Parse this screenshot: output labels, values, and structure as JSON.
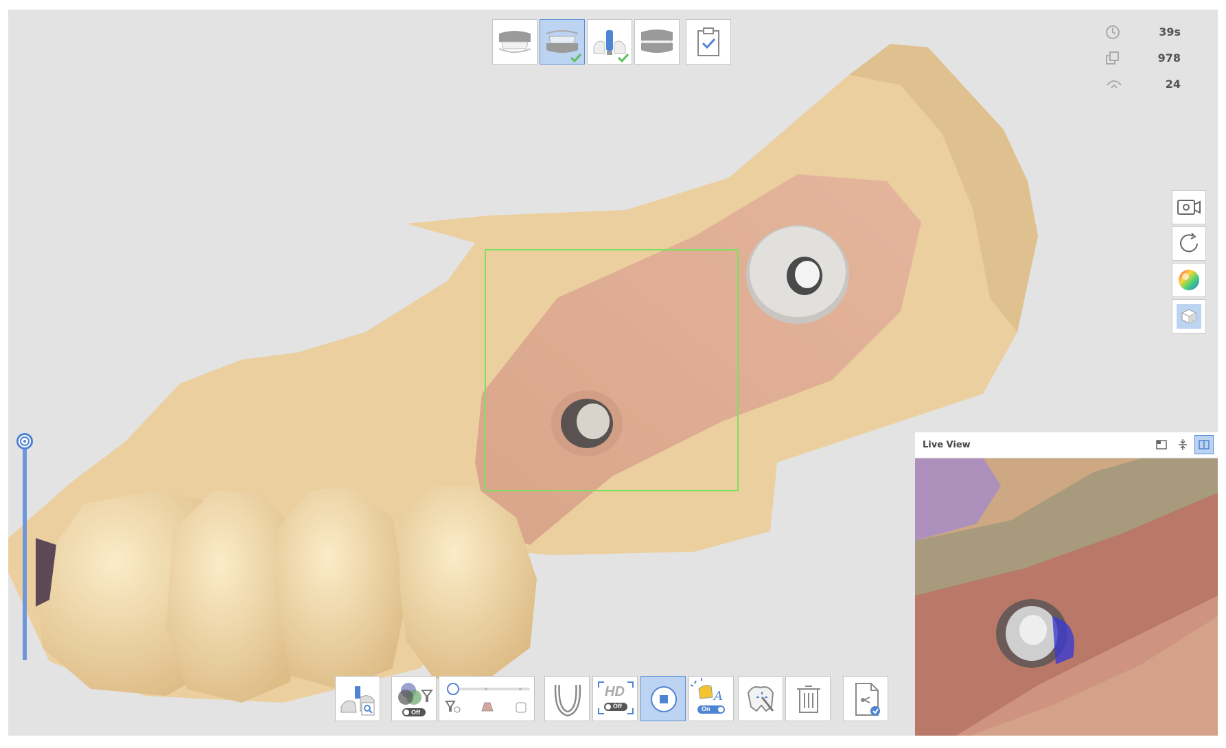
{
  "stages": [
    {
      "name": "upper-jaw",
      "selected": false,
      "completed": false
    },
    {
      "name": "lower-jaw",
      "selected": true,
      "completed": true
    },
    {
      "name": "scan-body",
      "selected": false,
      "completed": true
    },
    {
      "name": "occlusion",
      "selected": false,
      "completed": false
    },
    {
      "name": "review",
      "selected": false,
      "completed": false
    }
  ],
  "stats": {
    "time": "39s",
    "frames": "978",
    "third": "24"
  },
  "side_tools": [
    "video-record-icon",
    "reset-view-icon",
    "color-map-icon",
    "solid-view-icon"
  ],
  "bottom_tools": {
    "filter_toggle": "Off",
    "hd_label": "HD",
    "hd_toggle": "Off",
    "ai_toggle": "On"
  },
  "live_view": {
    "title": "Live View"
  },
  "colors": {
    "accent": "#4f83d4",
    "active_bg": "#bcd3f1",
    "scan_box": "#7ee062",
    "check": "#5cbf5c"
  }
}
